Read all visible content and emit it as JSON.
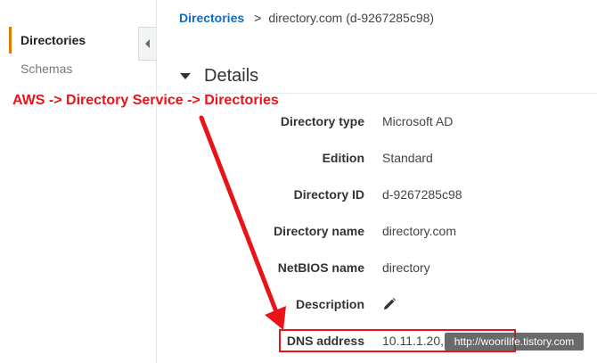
{
  "sidebar": {
    "items": [
      {
        "label": "Directories"
      },
      {
        "label": "Schemas"
      }
    ]
  },
  "breadcrumb": {
    "link": "Directories",
    "separator": ">",
    "current": "directory.com (d-9267285c98)"
  },
  "details": {
    "title": "Details",
    "rows": [
      {
        "label": "Directory type",
        "value": "Microsoft AD"
      },
      {
        "label": "Edition",
        "value": "Standard"
      },
      {
        "label": "Directory ID",
        "value": "d-9267285c98"
      },
      {
        "label": "Directory name",
        "value": "directory.com"
      },
      {
        "label": "NetBIOS name",
        "value": "directory"
      },
      {
        "label": "Description",
        "value": ""
      },
      {
        "label": "DNS address",
        "value": "10.11.1.20,"
      }
    ]
  },
  "annotation": {
    "text": "AWS -> Directory Service -> Directories"
  },
  "watermark": {
    "text": "http://woorilife.tistory.com"
  },
  "colors": {
    "accent_orange": "#e07b00",
    "link_blue": "#0f6cbd",
    "annotation_red": "#e8141a"
  }
}
